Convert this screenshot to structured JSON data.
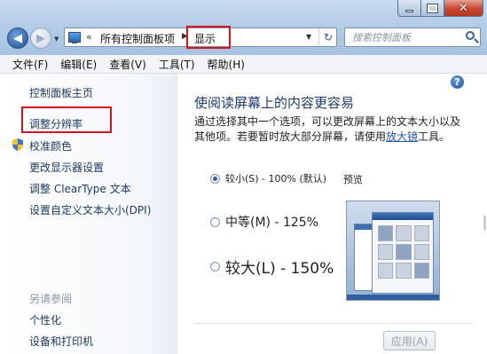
{
  "window": {
    "min_label": "–",
    "close_label": "✕"
  },
  "nav": {
    "back_icon": "◀",
    "forward_icon": "▶",
    "recent_dropdown": "▼"
  },
  "address": {
    "overflow": "«",
    "crumbs": [
      "所有控制面板项",
      "显示"
    ],
    "separator": "▶",
    "dropdown": "▼",
    "refresh": "↻"
  },
  "search": {
    "placeholder": "搜索控制面板"
  },
  "menubar": {
    "items": [
      "文件(F)",
      "编辑(E)",
      "查看(V)",
      "工具(T)",
      "帮助(H)"
    ]
  },
  "sidebar": {
    "home": "控制面板主页",
    "items": [
      "调整分辨率",
      "校准颜色",
      "更改显示器设置",
      "调整 ClearType 文本",
      "设置自定义文本大小(DPI)"
    ],
    "see_also_heading": "另请参阅",
    "see_also": [
      "个性化",
      "设备和打印机"
    ]
  },
  "main": {
    "help": "?",
    "title": "使阅读屏幕上的内容更容易",
    "desc_before": "通过选择其中一个选项，可以更改屏幕上的文本大小以及其他项。若要暂时放大部分屏幕，请使用",
    "desc_link": "放大镜",
    "desc_after": "工具。",
    "options": [
      {
        "label": "较小(S) - 100% (默认)",
        "checked": true
      },
      {
        "label": "中等(M) - 125%",
        "checked": false
      },
      {
        "label": "较大(L) - 150%",
        "checked": false
      }
    ],
    "preview_label": "预览",
    "apply_label": "应用(A)"
  },
  "colors": {
    "highlight": "#d4141e",
    "link": "#1e3962",
    "title": "#1e3a6e"
  }
}
